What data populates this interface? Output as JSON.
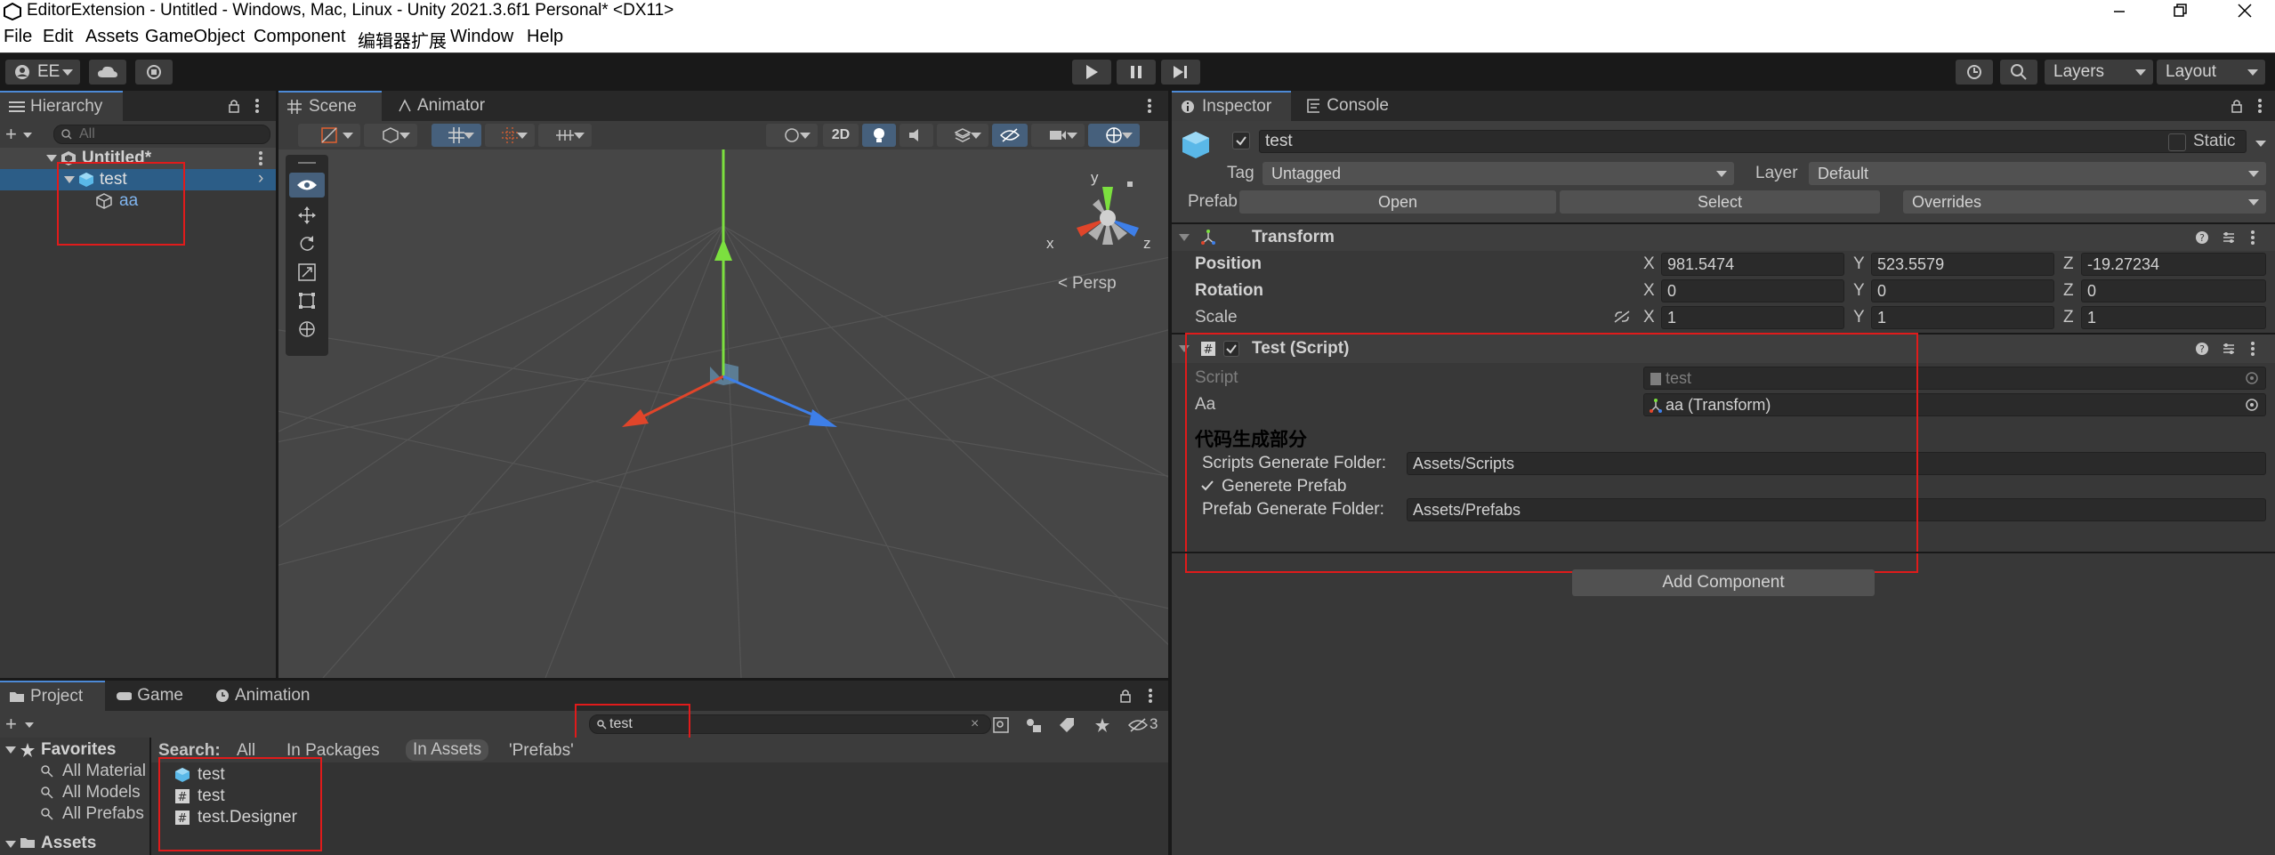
{
  "window": {
    "title": "EditorExtension - Untitled - Windows, Mac, Linux - Unity 2021.3.6f1 Personal* <DX11>"
  },
  "menu": [
    "File",
    "Edit",
    "Assets",
    "GameObject",
    "Component",
    "编辑器扩展",
    "Window",
    "Help"
  ],
  "toolbar": {
    "account_label": "EE",
    "layers_label": "Layers",
    "layout_label": "Layout"
  },
  "hierarchy": {
    "tab": "Hierarchy",
    "search_placeholder": "All",
    "scene": "Untitled*",
    "items": [
      "test",
      "aa"
    ]
  },
  "scene": {
    "tabs": [
      "Scene",
      "Animator"
    ],
    "btn_2d": "2D",
    "persp": "Persp",
    "gizmo_y": "y",
    "gizmo_x": "x",
    "gizmo_z": "z"
  },
  "project": {
    "tabs": [
      "Project",
      "Game",
      "Animation"
    ],
    "search_value": "test",
    "hidden_count": "3",
    "search_label": "Search:",
    "filters": [
      "All",
      "In Packages",
      "In Assets",
      "'Prefabs'"
    ],
    "favorites_label": "Favorites",
    "favorites": [
      "All Material",
      "All Models",
      "All Prefabs"
    ],
    "assets_label": "Assets",
    "results": [
      "test",
      "test",
      "test.Designer"
    ]
  },
  "inspector": {
    "tabs": [
      "Inspector",
      "Console"
    ],
    "object_name": "test",
    "static_label": "Static",
    "tag_label": "Tag",
    "tag_value": "Untagged",
    "layer_label": "Layer",
    "layer_value": "Default",
    "prefab_label": "Prefab",
    "open_btn": "Open",
    "select_btn": "Select",
    "overrides_btn": "Overrides",
    "transform": {
      "title": "Transform",
      "position": {
        "label": "Position",
        "x": "981.5474",
        "y": "523.5579",
        "z": "-19.27234"
      },
      "rotation": {
        "label": "Rotation",
        "x": "0",
        "y": "0",
        "z": "0"
      },
      "scale": {
        "label": "Scale",
        "x": "1",
        "y": "1",
        "z": "1"
      },
      "axis_x": "X",
      "axis_y": "Y",
      "axis_z": "Z"
    },
    "script": {
      "title": "Test (Script)",
      "script_label": "Script",
      "script_value": "test",
      "aa_label": "Aa",
      "aa_value": "aa (Transform)",
      "section_title": "代码生成部分",
      "scripts_folder_label": "Scripts Generate Folder:",
      "scripts_folder_value": "Assets/Scripts",
      "generate_prefab_label": "Generete Prefab",
      "prefab_folder_label": "Prefab Generate Folder:",
      "prefab_folder_value": "Assets/Prefabs"
    },
    "add_component": "Add Component"
  },
  "colors": {
    "accent": "#4d8ad6",
    "highlight_box": "#e01b1b",
    "panel": "#383838",
    "tab_bar": "#282828"
  }
}
